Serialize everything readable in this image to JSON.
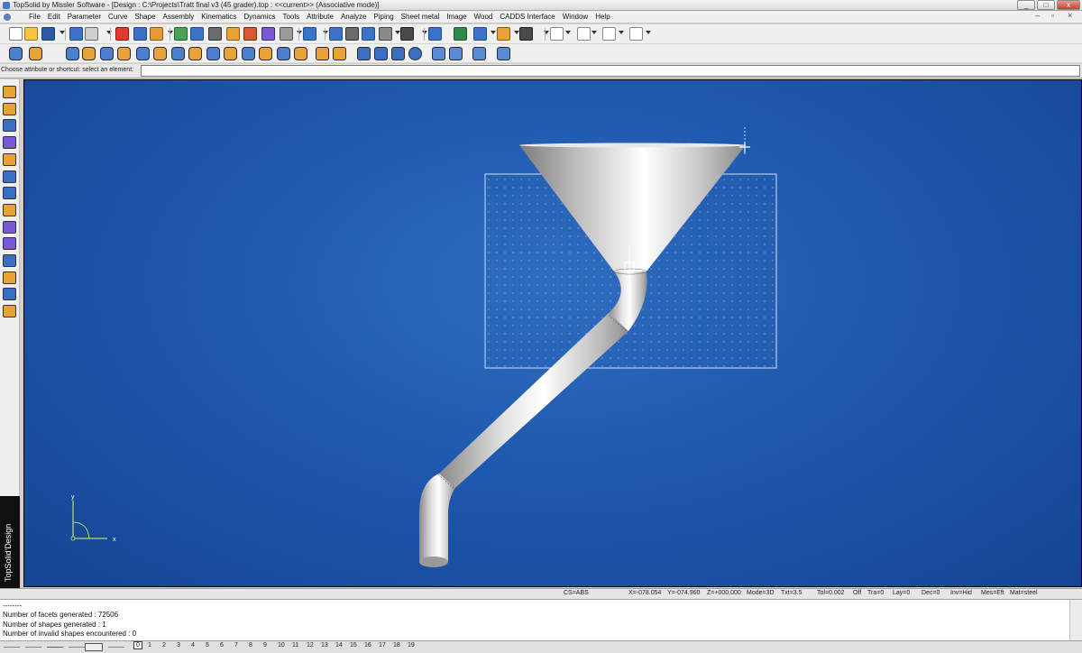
{
  "window": {
    "title": "TopSolid by Missler Software - [Design : C:\\Projects\\Tratt final v3 (45 grader).top : <<current>> (Associative mode)]",
    "controls": [
      "_",
      "□",
      "x"
    ]
  },
  "menubar": {
    "items": [
      "File",
      "Edit",
      "Parameter",
      "Curve",
      "Shape",
      "Assembly",
      "Kinematics",
      "Dynamics",
      "Tools",
      "Attribute",
      "Analyze",
      "Piping",
      "Sheet metal",
      "Image",
      "Wood",
      "CADDS Interface",
      "Window",
      "Help"
    ]
  },
  "hint": {
    "text": "Choose attribute or shortcut: select an element:",
    "input_value": ""
  },
  "side_label": "TopSolid'Design",
  "status": {
    "cs": "CS=ABS",
    "x": "X=-078.054",
    "y": "Y=-074.960",
    "z": "Z=+000.000",
    "mode": "Mode=3D",
    "txt": "Txt=3.5",
    "tol": "Tol=0.002",
    "off": "Off",
    "tra": "Tra=0",
    "lay": "Lay=0",
    "dec": "Dec=0",
    "inv": "Inv=Hid",
    "mes": "Mes=Eft",
    "mat": "Mat=steel"
  },
  "console": {
    "lines": [
      "--------",
      "Number of facets generated : 72506",
      "Number of shapes generated : 1",
      "Number of invalid shapes encountered : 0"
    ]
  },
  "layers": {
    "active": "0",
    "numbers": [
      "0",
      "1",
      "2",
      "3",
      "4",
      "5",
      "6",
      "7",
      "8",
      "9",
      "10",
      "11",
      "12",
      "13",
      "14",
      "15",
      "16",
      "17",
      "18",
      "19"
    ]
  },
  "axes": {
    "x_label": "x",
    "y_label": "y"
  },
  "colors": {
    "viewport_bg": "#1e58ad",
    "part_fill": "#c9c9c9",
    "grid_dots": "#9fbde6"
  }
}
